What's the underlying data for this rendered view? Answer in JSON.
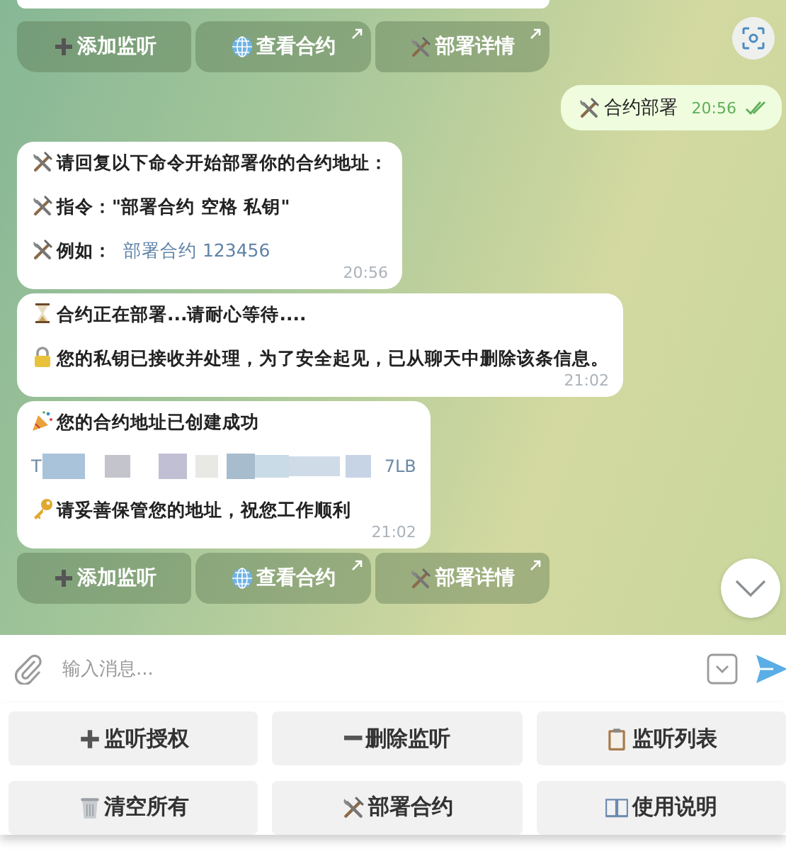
{
  "chat": {
    "items": [
      {
        "kind": "cut"
      },
      {
        "kind": "buttons",
        "buttons": [
          {
            "kind": "plus",
            "label": "添加监听",
            "link": false
          },
          {
            "kind": "globe",
            "label": "查看合约",
            "link": true
          },
          {
            "kind": "tools",
            "label": "部署详情",
            "link": true
          }
        ]
      },
      {
        "kind": "outgoing",
        "text": "合约部署",
        "time": "20:56",
        "read": true
      },
      {
        "kind": "incoming",
        "time": "20:56",
        "paragraphs": [
          {
            "kind": "tools",
            "text": "请回复以下命令开始部署你的合约地址："
          },
          {
            "kind": "tools",
            "text": "指令：\"部署合约 空格 私钥\""
          },
          {
            "kind": "code",
            "text": "例如：",
            "code": "部署合约 123456"
          }
        ]
      },
      {
        "kind": "incoming",
        "time": "21:02",
        "paragraphs": [
          {
            "kind": "hourglass",
            "text": "合约正在部署...请耐心等待...."
          },
          {
            "kind": "lock",
            "text": "您的私钥已接收并处理，为了安全起见，已从聊天中删除该条信息。"
          }
        ]
      },
      {
        "kind": "incoming",
        "time": "21:02",
        "paragraphs": [
          {
            "kind": "party",
            "text": "您的合约地址已创建成功"
          },
          {
            "kind": "address",
            "head": "T",
            "tail": "7LB"
          },
          {
            "kind": "key",
            "text": "请妥善保管您的地址，祝您工作顺利"
          }
        ]
      },
      {
        "kind": "buttons",
        "buttons": [
          {
            "kind": "plus",
            "label": "添加监听",
            "link": false
          },
          {
            "kind": "globe",
            "label": "查看合约",
            "link": true
          },
          {
            "kind": "tools",
            "label": "部署详情",
            "link": true
          }
        ]
      }
    ]
  },
  "composer": {
    "placeholder": "输入消息..."
  },
  "keyboard": [
    {
      "kind": "plus",
      "label": "监听授权"
    },
    {
      "kind": "minus",
      "label": "删除监听"
    },
    {
      "kind": "clipboard",
      "label": "监听列表"
    },
    {
      "kind": "trash",
      "label": "清空所有"
    },
    {
      "kind": "tools",
      "label": "部署合约"
    },
    {
      "kind": "book",
      "label": "使用说明"
    }
  ]
}
